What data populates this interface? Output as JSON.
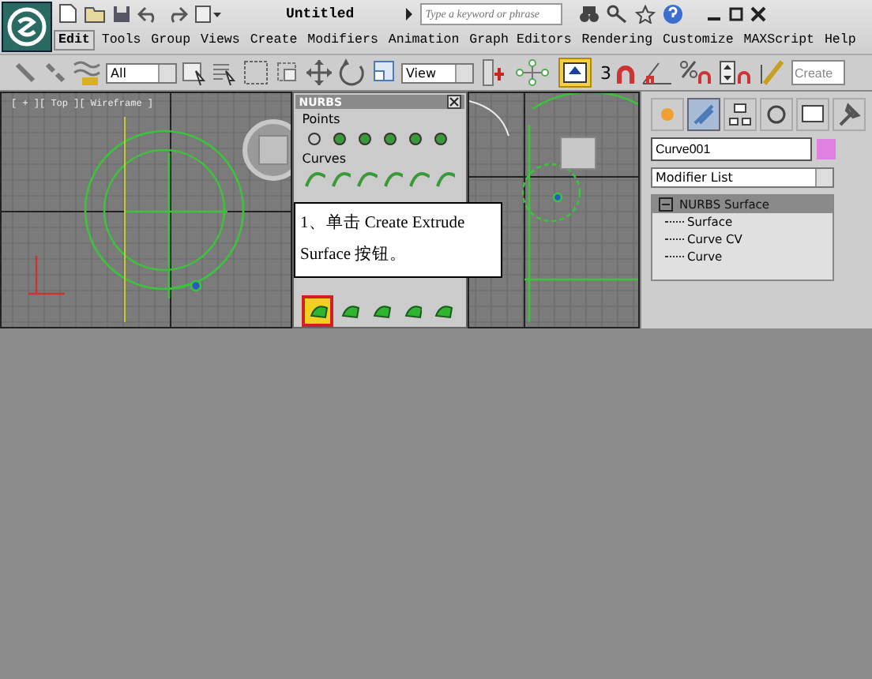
{
  "title_bar": {
    "title": "Untitled",
    "search": {
      "placeholder": "Type a keyword or phrase"
    }
  },
  "menu": [
    {
      "label": "Edit",
      "selected": true
    },
    {
      "label": "Tools",
      "selected": false
    },
    {
      "label": "Group",
      "selected": false
    },
    {
      "label": "Views",
      "selected": false
    },
    {
      "label": "Create",
      "selected": false
    },
    {
      "label": "Modifiers",
      "selected": false
    },
    {
      "label": "Animation",
      "selected": false
    },
    {
      "label": "Graph Editors",
      "selected": false
    },
    {
      "label": "Rendering",
      "selected": false
    },
    {
      "label": "Customize",
      "selected": false
    },
    {
      "label": "MAXScript",
      "selected": false
    },
    {
      "label": "Help",
      "selected": false
    }
  ],
  "toolbar": {
    "selection_filter": "All",
    "reference_coord": "View",
    "snap_label": "3",
    "create_field": "Create"
  },
  "viewport": {
    "label": "[ + ][ Top ][ Wireframe ]"
  },
  "nurbs_panel": {
    "title": "NURBS",
    "points_label": "Points",
    "curves_label": "Curves",
    "surface_tools": [
      {
        "selected": true
      },
      {
        "selected": false
      },
      {
        "selected": false
      },
      {
        "selected": false
      },
      {
        "selected": false
      }
    ]
  },
  "callout": {
    "text": "1、单击 Create Extrude Surface 按钮。"
  },
  "command_panel": {
    "tabs": [
      {
        "selected": false
      },
      {
        "selected": true
      },
      {
        "selected": false
      },
      {
        "selected": false
      },
      {
        "selected": false
      },
      {
        "selected": false
      }
    ],
    "object_name": "Curve001",
    "modifier_list": "Modifier List",
    "stack": {
      "label": "NURBS Surface",
      "selected": true,
      "expanded": true,
      "children": [
        {
          "label": "Surface"
        },
        {
          "label": "Curve CV"
        },
        {
          "label": "Curve"
        }
      ]
    }
  }
}
